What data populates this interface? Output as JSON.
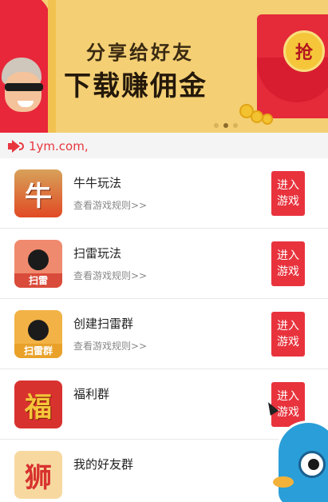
{
  "banner": {
    "headline_top": "分享给好友",
    "headline_main": "下载赚佣金",
    "envelope_label": "抢",
    "slide_count": 3,
    "active_slide": 2
  },
  "announcement": {
    "text": "1ym.com,"
  },
  "games": [
    {
      "title": "牛牛玩法",
      "subtitle": "查看游戏规则>>",
      "button": "进入\n游戏",
      "icon_glyph": "牛",
      "icon_tag": ""
    },
    {
      "title": "扫雷玩法",
      "subtitle": "查看游戏规则>>",
      "button": "进入\n游戏",
      "icon_glyph": "●",
      "icon_tag": "扫雷"
    },
    {
      "title": "创建扫雷群",
      "subtitle": "查看游戏规则>>",
      "button": "进入\n游戏",
      "icon_glyph": "●",
      "icon_tag": "扫雷群"
    },
    {
      "title": "福利群",
      "subtitle": "",
      "button": "进入\n游戏",
      "icon_glyph": "福",
      "icon_tag": ""
    },
    {
      "title": "我的好友群",
      "subtitle": "",
      "button": "",
      "icon_glyph": "狮",
      "icon_tag": ""
    }
  ],
  "colors": {
    "accent_red": "#e8333d",
    "banner_yellow": "#f4cf74",
    "announce_bg": "#f4f4f4"
  }
}
